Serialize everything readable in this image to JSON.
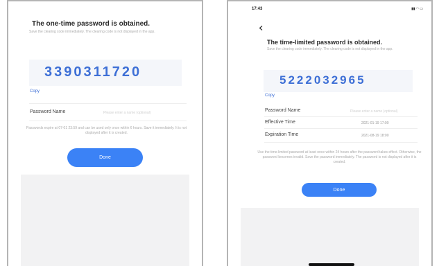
{
  "screen_left": {
    "title": "The one-time password is obtained.",
    "subtitle": "Save the clearing code immediately. The clearing code is not displayed in the app.",
    "password": "3390311720",
    "copy_label": "Copy",
    "password_name_label": "Password Name",
    "password_name_placeholder": "Please enter a name (optional)",
    "note": "Passwords expire at 07-01 23:59 and can be used only once within 6 hours. Save it immediately. It is not displayed after it is created.",
    "done_label": "Done"
  },
  "screen_right": {
    "status_time": "17:43",
    "status_icons": "▮▮ ◠ ▭",
    "back_icon": "chevron-left-icon",
    "title": "The time-limited password is obtained.",
    "subtitle": "Save the clearing code immediately. The clearing code is not displayed in the app.",
    "password": "5222032965",
    "copy_label": "Copy",
    "password_name_label": "Password Name",
    "password_name_placeholder": "Please enter a name (optional)",
    "effective_time_label": "Effective Time",
    "effective_time_value": "2021-01-19 17:00",
    "expiration_time_label": "Expiration Time",
    "expiration_time_value": "2021-08-19 18:00",
    "note": "Use the time-limited password at least once within 24 hours after the password takes effect. Otherwise, the password becomes invalid. Save the password immediately. The password is not displayed after it is created.",
    "done_label": "Done"
  },
  "colors": {
    "accent": "#3b82f6",
    "code_text": "#3d6fd6",
    "frame_border": "#b4b4b4",
    "empty_area": "#f2f2f3"
  }
}
